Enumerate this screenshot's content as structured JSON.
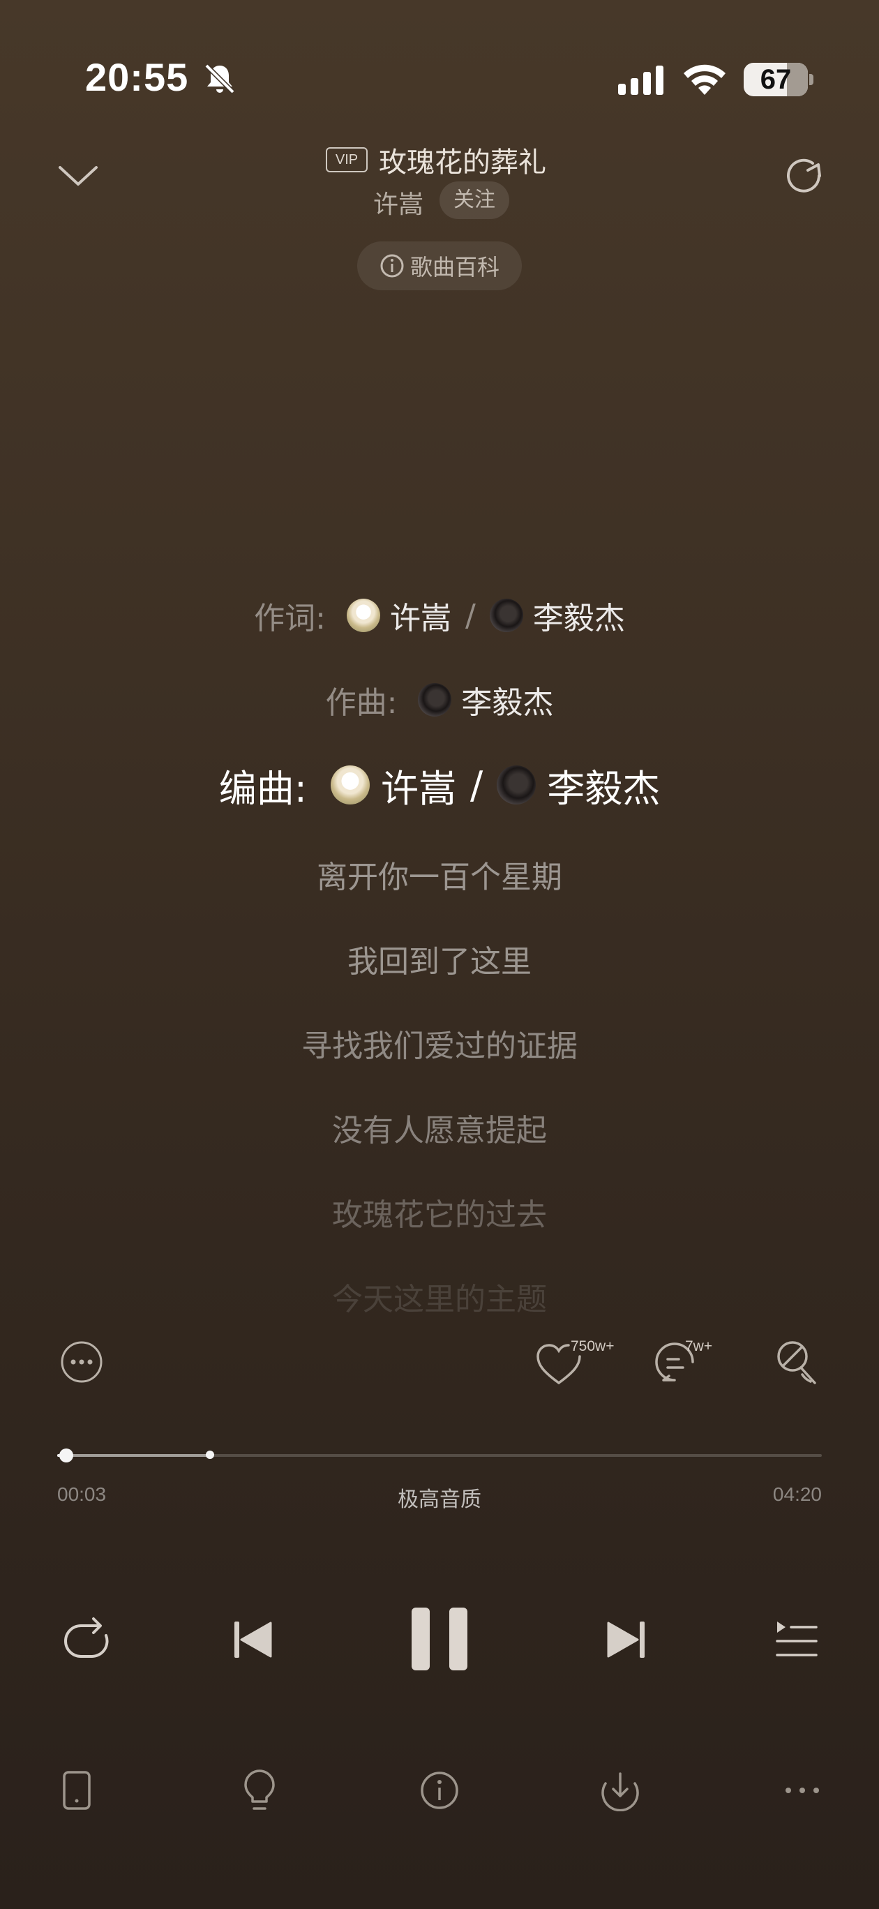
{
  "status_bar": {
    "time": "20:55",
    "battery": "67",
    "mute_icon": "bell-slash-icon"
  },
  "header": {
    "vip_badge": "VIP",
    "song_title": "玫瑰花的葬礼",
    "artist": "许嵩",
    "follow_label": "关注",
    "wiki_label": "歌曲百科"
  },
  "credits": {
    "lyricist_label": "作词:",
    "composer_label": "作曲:",
    "arranger_label": "编曲:",
    "separator": "/",
    "person_a": "许嵩",
    "person_b": "李毅杰"
  },
  "lyrics": [
    {
      "text": "离开你一百个星期",
      "opacity": 0.5
    },
    {
      "text": "我回到了这里",
      "opacity": 0.5
    },
    {
      "text": "寻找我们爱过的证据",
      "opacity": 0.45
    },
    {
      "text": "没有人愿意提起",
      "opacity": 0.42
    },
    {
      "text": "玫瑰花它的过去",
      "opacity": 0.28
    },
    {
      "text": "今天这里的主题",
      "opacity": 0.12
    }
  ],
  "actions": {
    "like_count": "750w+",
    "comment_count": "7w+"
  },
  "playback": {
    "elapsed": "00:03",
    "total": "04:20",
    "quality": "极高音质",
    "played_fraction": 0.012,
    "buffered_fraction": 0.2
  },
  "colors": {
    "background_top": "#473829",
    "background_bottom": "#2a211b",
    "text_primary": "#ffffff"
  }
}
